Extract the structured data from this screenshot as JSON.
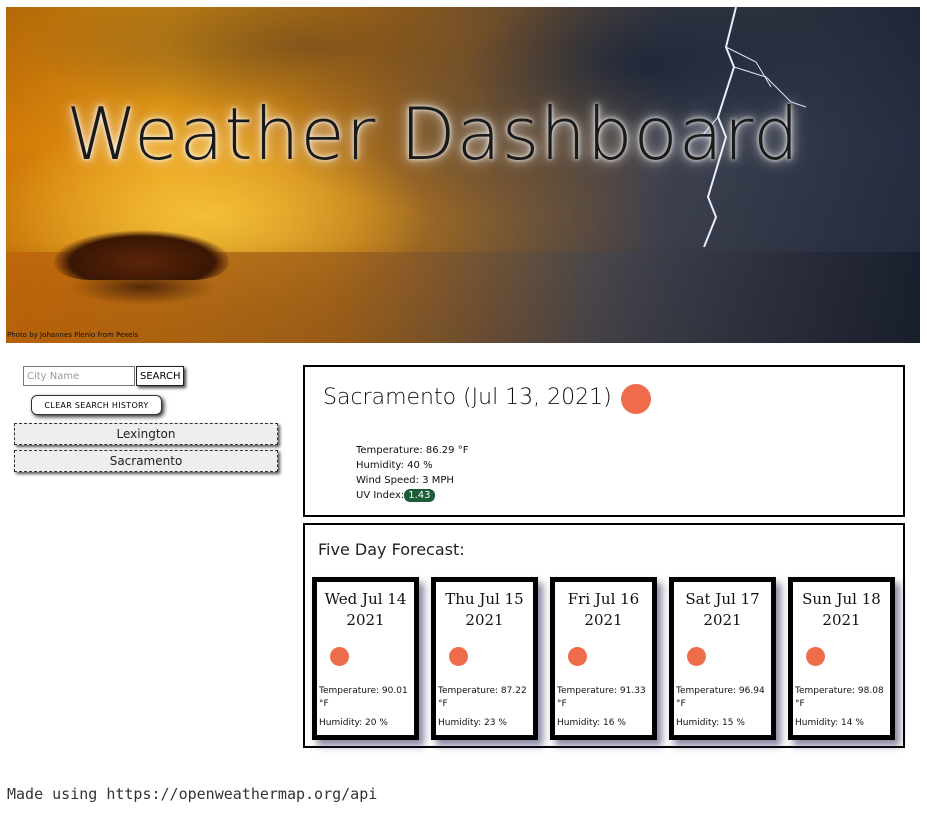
{
  "hero": {
    "title": "Weather Dashboard",
    "credit": "Photo by Johannes Plenio from Pexels"
  },
  "sidebar": {
    "search_placeholder": "City Name",
    "search_label": "SEARCH",
    "clear_label": "CLEAR SEARCH HISTORY",
    "history": [
      "Lexington",
      "Sacramento"
    ]
  },
  "current": {
    "title": "Sacramento (Jul 13, 2021)",
    "icon": "sun-icon",
    "temperature": "Temperature: 86.29 °F",
    "humidity": "Humidity: 40 %",
    "wind": "Wind Speed: 3 MPH",
    "uv_label": "UV Index:",
    "uv_value": "1.43",
    "uv_color": "#1c5c38",
    "icon_color": "#ef6c4b"
  },
  "forecast": {
    "title": "Five Day Forecast:",
    "days": [
      {
        "date": "Wed Jul 14",
        "year": "2021",
        "temp": "Temperature: 90.01 °F",
        "humidity": "Humidity: 20 %"
      },
      {
        "date": "Thu Jul 15",
        "year": "2021",
        "temp": "Temperature: 87.22 °F",
        "humidity": "Humidity: 23 %"
      },
      {
        "date": "Fri Jul 16",
        "year": "2021",
        "temp": "Temperature: 91.33 °F",
        "humidity": "Humidity: 16 %"
      },
      {
        "date": "Sat Jul 17",
        "year": "2021",
        "temp": "Temperature: 96.94 °F",
        "humidity": "Humidity: 15 %"
      },
      {
        "date": "Sun Jul 18",
        "year": "2021",
        "temp": "Temperature: 98.08 °F",
        "humidity": "Humidity: 14 %"
      }
    ]
  },
  "footer": {
    "text": "Made using https://openweathermap.org/api"
  }
}
